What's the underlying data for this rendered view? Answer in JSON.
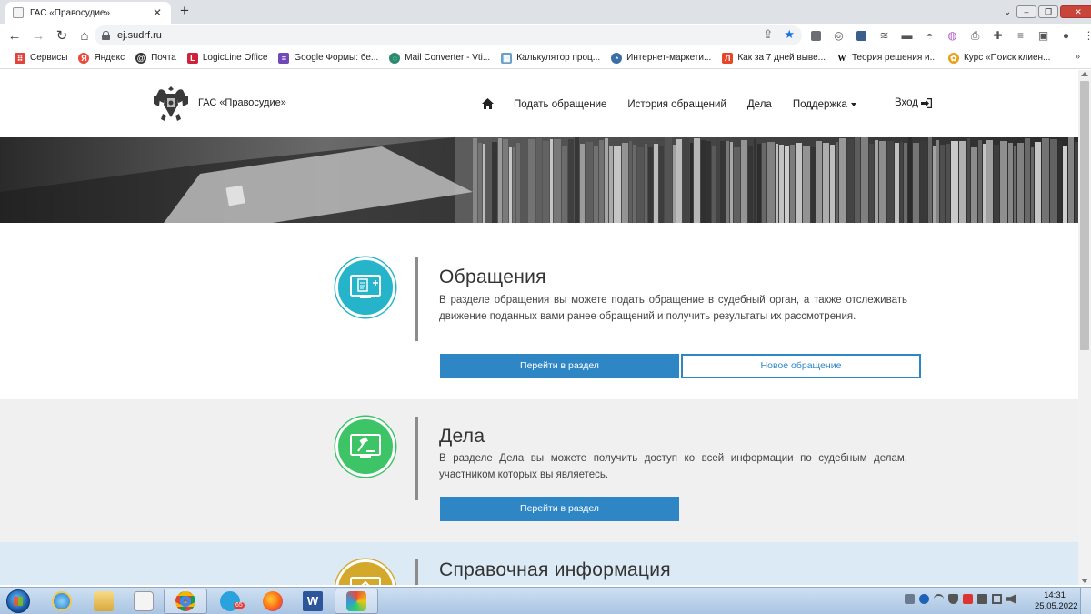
{
  "browser": {
    "tab_title": "ГАС «Правосудие»",
    "tab_close": "✕",
    "new_tab": "+",
    "url": "ej.sudrf.ru",
    "bookmarks": [
      {
        "label": "Сервисы",
        "icon": "apps-grid-icon",
        "color": "#e0453b"
      },
      {
        "label": "Яндекс",
        "icon": "yandex-icon",
        "color": "#e94b3c"
      },
      {
        "label": "Почта",
        "icon": "mail-icon",
        "color": "#333333"
      },
      {
        "label": "LogicLine Office",
        "icon": "logicline-icon",
        "color": "#d0213c"
      },
      {
        "label": "Google Формы: бе...",
        "icon": "google-forms-icon",
        "color": "#7248b9"
      },
      {
        "label": "Mail Converter - Vti...",
        "icon": "converter-icon",
        "color": "#2b8a6e"
      },
      {
        "label": "Калькулятор проц...",
        "icon": "calculator-icon",
        "color": "#6aa0c8"
      },
      {
        "label": "Интернет-маркети...",
        "icon": "marketing-icon",
        "color": "#3a6ea5"
      },
      {
        "label": "Как за 7 дней выве...",
        "icon": "article-icon",
        "color": "#e8462b"
      },
      {
        "label": "Теория решения и...",
        "icon": "wikipedia-icon",
        "color": "#000000"
      },
      {
        "label": "Курс «Поиск клиен...",
        "icon": "course-icon",
        "color": "#e8a21a"
      }
    ],
    "bookmarks_more": "»"
  },
  "site": {
    "name": "ГАС «Правосудие»",
    "nav": {
      "home_icon": "home-icon",
      "items": [
        "Подать обращение",
        "История обращений",
        "Дела",
        "Поддержка"
      ],
      "login": "Вход"
    }
  },
  "sections": [
    {
      "title": "Обращения",
      "text": "В разделе обращения вы можете подать обращение в судебный орган, а также отслеживать движение поданных вами ранее обращений и получить результаты их рассмотрения.",
      "primary_button": "Перейти в раздел",
      "secondary_button": "Новое обращение",
      "icon": "document-monitor-icon",
      "color": "#25b4c9"
    },
    {
      "title": "Дела",
      "text": "В разделе Дела вы можете получить доступ ко всей информации по судебным делам, участником которых вы являетесь.",
      "primary_button": "Перейти в раздел",
      "icon": "gavel-monitor-icon",
      "color": "#3cc467"
    },
    {
      "title": "Справочная информация",
      "icon": "info-monitor-icon",
      "color": "#d4a82a"
    }
  ],
  "taskbar": {
    "clock_time": "14:31",
    "clock_date": "25.05.2022",
    "telegram_badge": "65"
  }
}
